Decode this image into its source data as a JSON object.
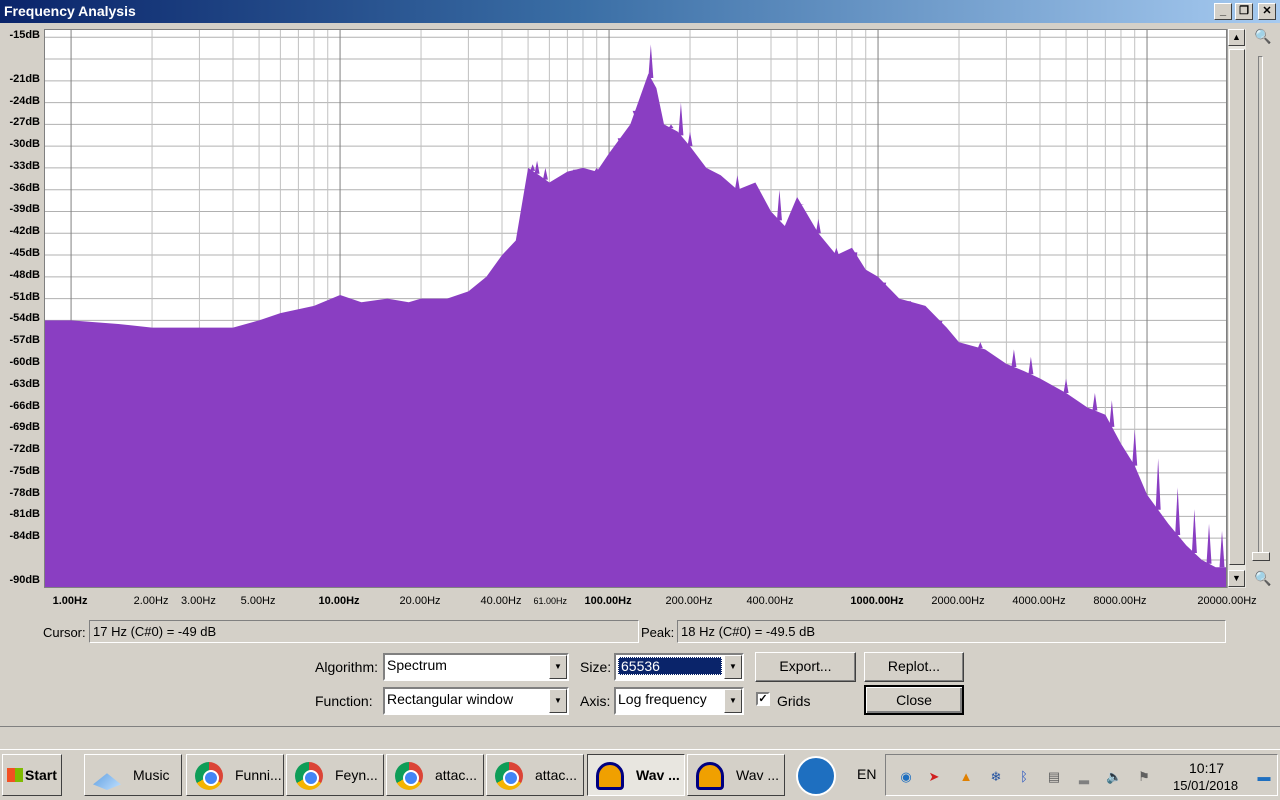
{
  "window": {
    "title": "Frequency Analysis",
    "min_glyph": "_",
    "restore_glyph": "❐",
    "close_glyph": "✕"
  },
  "y_axis": [
    "-15dB",
    "-21dB",
    "-24dB",
    "-27dB",
    "-30dB",
    "-33dB",
    "-36dB",
    "-39dB",
    "-42dB",
    "-45dB",
    "-48dB",
    "-51dB",
    "-54dB",
    "-57dB",
    "-60dB",
    "-63dB",
    "-66dB",
    "-69dB",
    "-72dB",
    "-75dB",
    "-78dB",
    "-81dB",
    "-84dB",
    "-90dB"
  ],
  "x_axis": [
    {
      "label": "1.00Hz",
      "freq": 1,
      "bold": true
    },
    {
      "label": "2.00Hz",
      "freq": 2
    },
    {
      "label": "3.00Hz",
      "freq": 3
    },
    {
      "label": "5.00Hz",
      "freq": 5
    },
    {
      "label": "10.00Hz",
      "freq": 10,
      "bold": true
    },
    {
      "label": "20.00Hz",
      "freq": 20
    },
    {
      "label": "40.00Hz",
      "freq": 40
    },
    {
      "label": "61.00Hz",
      "freq": 61,
      "small": true
    },
    {
      "label": "100.00Hz",
      "freq": 100,
      "bold": true
    },
    {
      "label": "200.00Hz",
      "freq": 200
    },
    {
      "label": "400.00Hz",
      "freq": 400
    },
    {
      "label": "1000.00Hz",
      "freq": 1000,
      "bold": true
    },
    {
      "label": "2000.00Hz",
      "freq": 2000
    },
    {
      "label": "4000.00Hz",
      "freq": 4000
    },
    {
      "label": "8000.00Hz",
      "freq": 8000
    },
    {
      "label": "20000.00Hz",
      "freq": 20000
    }
  ],
  "chart_data": {
    "type": "area",
    "x_scale": "log",
    "xlim": [
      0.8,
      20000
    ],
    "ylim": [
      -91,
      -14
    ],
    "xlabel": "",
    "ylabel": "",
    "grid": true,
    "color": "#8a3ec2",
    "series": [
      {
        "x": [
          0.8,
          1,
          1.5,
          2,
          3,
          4,
          5,
          6,
          8,
          10,
          12,
          15,
          18,
          20,
          25,
          30,
          35,
          40,
          45,
          50,
          55,
          60,
          70,
          80,
          90,
          100,
          120,
          140,
          150,
          160,
          180,
          200,
          230,
          260,
          300,
          350,
          400,
          450,
          500,
          600,
          700,
          800,
          900,
          1000,
          1200,
          1500,
          1800,
          2000,
          2500,
          3000,
          3500,
          4000,
          5000,
          6000,
          7000,
          8000,
          9000,
          10000,
          12000,
          14000,
          16000,
          18000,
          20000
        ],
        "y": [
          -54,
          -54,
          -54.5,
          -55,
          -55,
          -55,
          -54,
          -53,
          -52,
          -50.5,
          -51.5,
          -51,
          -51.5,
          -51,
          -51,
          -50,
          -48,
          -45,
          -43,
          -33,
          -34,
          -35,
          -33.5,
          -33,
          -33.5,
          -31,
          -27,
          -20,
          -22,
          -27,
          -28,
          -30,
          -33,
          -34,
          -36,
          -35,
          -39,
          -41,
          -37,
          -42,
          -45,
          -44,
          -47,
          -48,
          -51,
          -52,
          -55,
          -57,
          -58,
          -60,
          -61,
          -62,
          -64,
          -66,
          -67,
          -71,
          -74,
          -78,
          -82,
          -85,
          -87,
          -88,
          -88
        ],
        "peaks": [
          [
            52,
            -32.5
          ],
          [
            54,
            -32
          ],
          [
            58,
            -33
          ],
          [
            75,
            -34
          ],
          [
            90,
            -33
          ],
          [
            100,
            -31
          ],
          [
            110,
            -30
          ],
          [
            125,
            -26
          ],
          [
            143,
            -16
          ],
          [
            150,
            -22
          ],
          [
            170,
            -27
          ],
          [
            185,
            -24
          ],
          [
            200,
            -28
          ],
          [
            230,
            -33
          ],
          [
            300,
            -34
          ],
          [
            350,
            -35
          ],
          [
            430,
            -36
          ],
          [
            520,
            -38
          ],
          [
            600,
            -40
          ],
          [
            700,
            -44
          ],
          [
            820,
            -47
          ],
          [
            1050,
            -50
          ],
          [
            1300,
            -53
          ],
          [
            1700,
            -55
          ],
          [
            2400,
            -57
          ],
          [
            3200,
            -58
          ],
          [
            3700,
            -59
          ],
          [
            5000,
            -62
          ],
          [
            6400,
            -64
          ],
          [
            7400,
            -65
          ],
          [
            9000,
            -69
          ],
          [
            11000,
            -73
          ],
          [
            13000,
            -77
          ],
          [
            15000,
            -80
          ],
          [
            17000,
            -82
          ],
          [
            19000,
            -83
          ]
        ]
      }
    ]
  },
  "cursor": {
    "label": "Cursor:",
    "value": "17 Hz (C#0) = -49 dB"
  },
  "peak": {
    "label": "Peak:",
    "value": "18 Hz (C#0) = -49.5 dB"
  },
  "controls": {
    "algorithm_label": "Algorithm:",
    "algorithm_value": "Spectrum",
    "function_label": "Function:",
    "function_value": "Rectangular window",
    "size_label": "Size:",
    "size_value": "65536",
    "axis_label": "Axis:",
    "axis_value": "Log frequency",
    "grids_label": "Grids",
    "grids_checked": "✓",
    "export_label": "Export...",
    "replot_label": "Replot...",
    "close_label": "Close"
  },
  "taskbar": {
    "start_label": "Start",
    "items": [
      {
        "label": "Music",
        "icon": "music-icon"
      },
      {
        "label": "Funni...",
        "icon": "chrome-icon"
      },
      {
        "label": "Feyn...",
        "icon": "chrome-icon"
      },
      {
        "label": "attac...",
        "icon": "chrome-icon"
      },
      {
        "label": "attac...",
        "icon": "chrome-icon"
      },
      {
        "label": "Wav ...",
        "icon": "audacity-icon",
        "active": true
      },
      {
        "label": "Wav ...",
        "icon": "audacity-icon"
      }
    ],
    "language": "EN",
    "time": "10:17",
    "date": "15/01/2018"
  }
}
